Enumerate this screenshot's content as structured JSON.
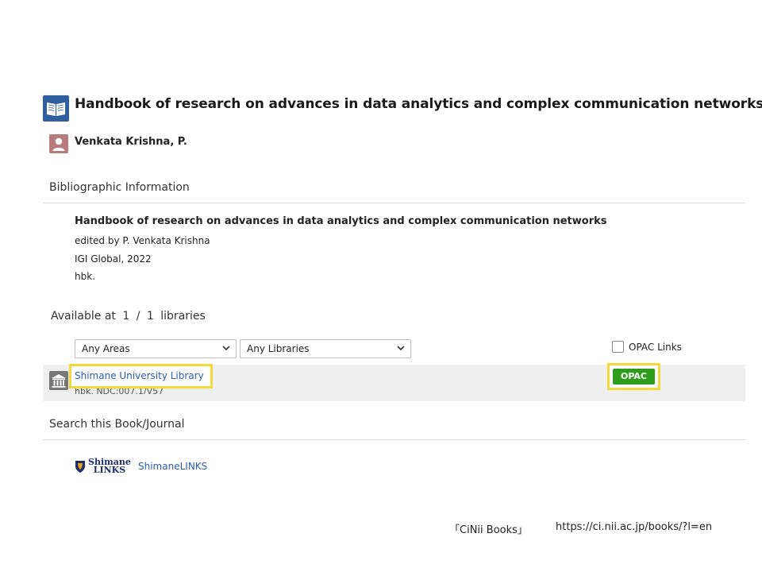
{
  "record": {
    "title": "Handbook of research on advances in data analytics and complex communication networks",
    "author": "Venkata Krishna, P."
  },
  "bibliographic": {
    "heading": "Bibliographic Information",
    "title": "Handbook of research on advances in data analytics and complex communication networks",
    "statement": "edited by P. Venkata Krishna",
    "publisher": "IGI Global, 2022",
    "format": "hbk."
  },
  "holdings": {
    "prefix": "Available at",
    "count": "1",
    "separator": "/",
    "total": "1",
    "suffix": "libraries",
    "areas_filter": {
      "selected": "Any Areas"
    },
    "libraries_filter": {
      "selected": "Any Libraries"
    },
    "opac_links_label": "OPAC Links",
    "opac_links_checked": false,
    "items": [
      {
        "library": "Shimane University Library",
        "detail": "hbk.  NDC:007.1/V57",
        "opac_label": "OPAC"
      }
    ]
  },
  "search": {
    "heading": "Search this Book/Journal",
    "logo_line1": "Shimane",
    "logo_line2": "LINKS",
    "link_label": "ShimaneLINKS"
  },
  "footer": {
    "source": "「CiNii Books」",
    "url": "https://ci.nii.ac.jp/books/?l=en"
  },
  "colors": {
    "highlight": "#f5d83a",
    "opac_button": "#2e9c1d",
    "link": "#2a5db0",
    "book_icon": "#2f5f9e",
    "person_icon": "#b77b7b"
  },
  "icons": {
    "record": "book-icon",
    "author": "person-icon",
    "library": "library-building-icon",
    "dropdown": "chevron-down-icon",
    "search_logo": "shimane-links-logo"
  }
}
